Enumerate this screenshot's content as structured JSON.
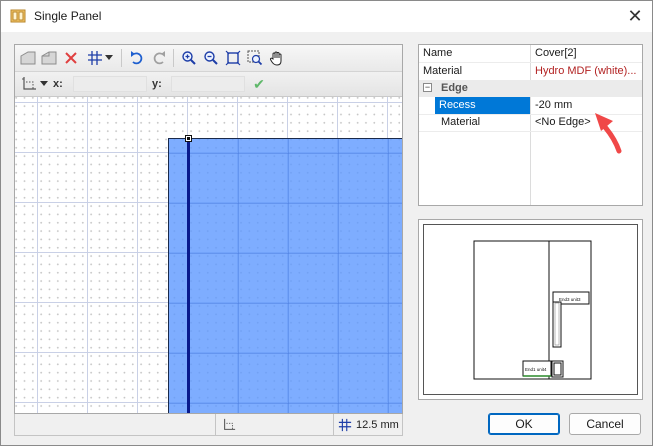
{
  "window": {
    "title": "Single Panel",
    "close_glyph": "✕"
  },
  "toolbar": {
    "icons": [
      "panel-new-icon",
      "panel-copy-icon",
      "delete-icon",
      "grid-icon",
      "undo-icon",
      "redo-icon",
      "zoom-in-icon",
      "zoom-out-icon",
      "zoom-fit-icon",
      "zoom-window-icon",
      "pan-hand-icon"
    ],
    "x_label": "x:",
    "y_label": "y:",
    "x_value": "",
    "y_value": "",
    "accept_glyph": "✔"
  },
  "statusbar": {
    "grid_size": "12.5 mm"
  },
  "properties": {
    "rows": [
      {
        "name": "Name",
        "value": "Cover[2]"
      },
      {
        "name": "Material",
        "value": "Hydro MDF (white)..."
      }
    ],
    "category": {
      "toggle": "−",
      "label": "Edge"
    },
    "edge_rows": [
      {
        "name": "Recess",
        "value": "-20 mm"
      },
      {
        "name": "Material",
        "value": "<No Edge>"
      }
    ]
  },
  "preview": {
    "label_a": "End3 unit3",
    "label_b": "End1 unit4"
  },
  "buttons": {
    "ok": "OK",
    "cancel": "Cancel"
  },
  "colors": {
    "accent": "#0078d7",
    "panel_fill": "#5a96ff",
    "edge_line": "#0a1a8c",
    "annotation_arrow": "#f04848"
  }
}
